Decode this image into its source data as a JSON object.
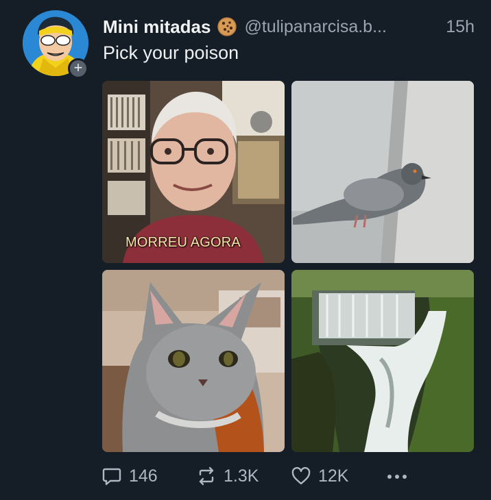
{
  "post": {
    "display_name": "Mini mitadas",
    "handle": "@tulipanarcisa.b...",
    "time": "15h",
    "text": "Pick your poison"
  },
  "media": {
    "images": [
      {
        "alt": "older man with glasses",
        "caption": "MORREU AGORA"
      },
      {
        "alt": "pigeon"
      },
      {
        "alt": "grey cat"
      },
      {
        "alt": "waterfall"
      }
    ]
  },
  "actions": {
    "replies": "146",
    "reposts": "1.3K",
    "likes": "12K"
  },
  "icons": [
    "add-icon",
    "cookie-icon",
    "reply-icon",
    "repost-icon",
    "like-icon",
    "more-icon"
  ]
}
